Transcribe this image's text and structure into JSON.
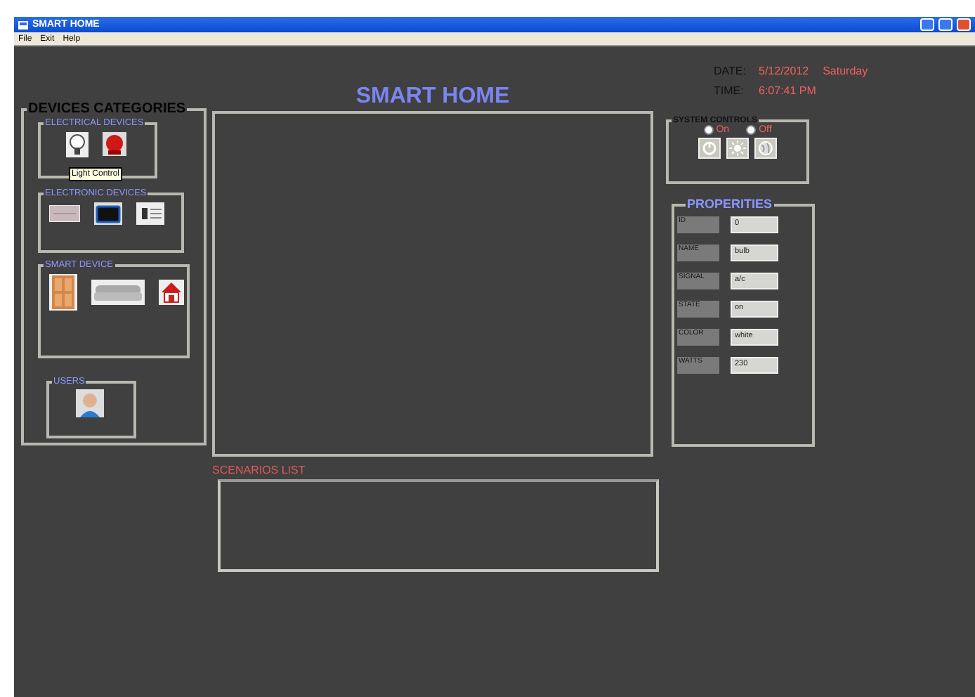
{
  "window": {
    "title": "SMART HOME"
  },
  "menu": [
    "File",
    "Exit",
    "Help"
  ],
  "header": {
    "title": "SMART HOME",
    "date_label": "DATE:",
    "date_value": "5/12/2012",
    "day": "Saturday",
    "time_label": "TIME:",
    "time_value": "6:07:41 PM"
  },
  "devices_categories": {
    "title": "DEVICES CATEGORIES",
    "groups": [
      {
        "title": "ELECTRICAL DEVICES",
        "items": [
          {
            "kind": "bulb"
          },
          {
            "kind": "bell"
          }
        ],
        "tooltip": "Light Control"
      },
      {
        "title": "ELECTRONIC DEVICES",
        "items": [
          {
            "kind": "panel"
          },
          {
            "kind": "tv"
          },
          {
            "kind": "document"
          }
        ]
      },
      {
        "title": "SMART DEVICE",
        "items": [
          {
            "kind": "door"
          },
          {
            "kind": "sofa"
          },
          {
            "kind": "house"
          }
        ]
      },
      {
        "title": "USERS",
        "items": [
          {
            "kind": "user"
          }
        ]
      }
    ]
  },
  "system_controls": {
    "title": "SYSTEM CONTROLS",
    "radios": [
      {
        "label": "On",
        "selected": false
      },
      {
        "label": "Off",
        "selected": false
      }
    ],
    "buttons": [
      {
        "kind": "power"
      },
      {
        "kind": "sun"
      },
      {
        "kind": "globe"
      }
    ]
  },
  "properties": {
    "title": "PROPERITIES",
    "fields": [
      {
        "label": "ID",
        "value": "0"
      },
      {
        "label": "NAME",
        "value": "bulb"
      },
      {
        "label": "SIGNAL",
        "value": "a/c"
      },
      {
        "label": "STATE",
        "value": "on"
      },
      {
        "label": "COLOR",
        "value": "white"
      },
      {
        "label": "WATTS",
        "value": "230"
      }
    ]
  },
  "scenarios_list": {
    "label": "SCENARIOS LIST"
  }
}
